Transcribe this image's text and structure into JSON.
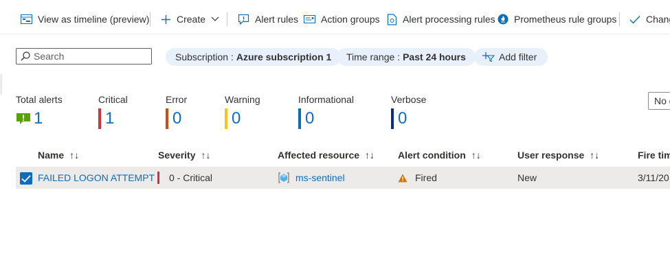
{
  "toolbar": {
    "timeline": "View as timeline (preview)",
    "create": "Create",
    "alert_rules": "Alert rules",
    "action_groups": "Action groups",
    "processing_rules": "Alert processing rules",
    "prometheus": "Prometheus rule groups",
    "change": "Chang"
  },
  "filters": {
    "search_placeholder": "Search",
    "subscription_label": "Subscription :",
    "subscription_value": "Azure subscription 1",
    "time_label": "Time range :",
    "time_value": "Past 24 hours",
    "add_filter": "Add filter"
  },
  "summary": [
    {
      "label": "Total alerts",
      "value": "1",
      "color": "#57a300"
    },
    {
      "label": "Critical",
      "value": "1",
      "color": "#d13438"
    },
    {
      "label": "Error",
      "value": "0",
      "color": "#ca5010"
    },
    {
      "label": "Warning",
      "value": "0",
      "color": "#f2c811"
    },
    {
      "label": "Informational",
      "value": "0",
      "color": "#0f6cbd"
    },
    {
      "label": "Verbose",
      "value": "0",
      "color": "#0a2b8a"
    }
  ],
  "group_by": "No g",
  "table": {
    "columns": [
      "Name",
      "Severity",
      "Affected resource",
      "Alert condition",
      "User response",
      "Fire time"
    ],
    "sort_glyph": "↑↓",
    "rows": [
      {
        "selected": true,
        "name": "FAILED LOGON ATTEMPT",
        "severity": "0 - Critical",
        "resource": "ms-sentinel",
        "condition": "Fired",
        "response": "New",
        "fire_time": "3/11/20"
      }
    ]
  },
  "colors": {
    "accent": "#0f6cbd",
    "critical": "#d13438",
    "pill_bg": "#e8f1fb",
    "selected_row": "#edebe9",
    "fired_warning": "#d47500"
  }
}
